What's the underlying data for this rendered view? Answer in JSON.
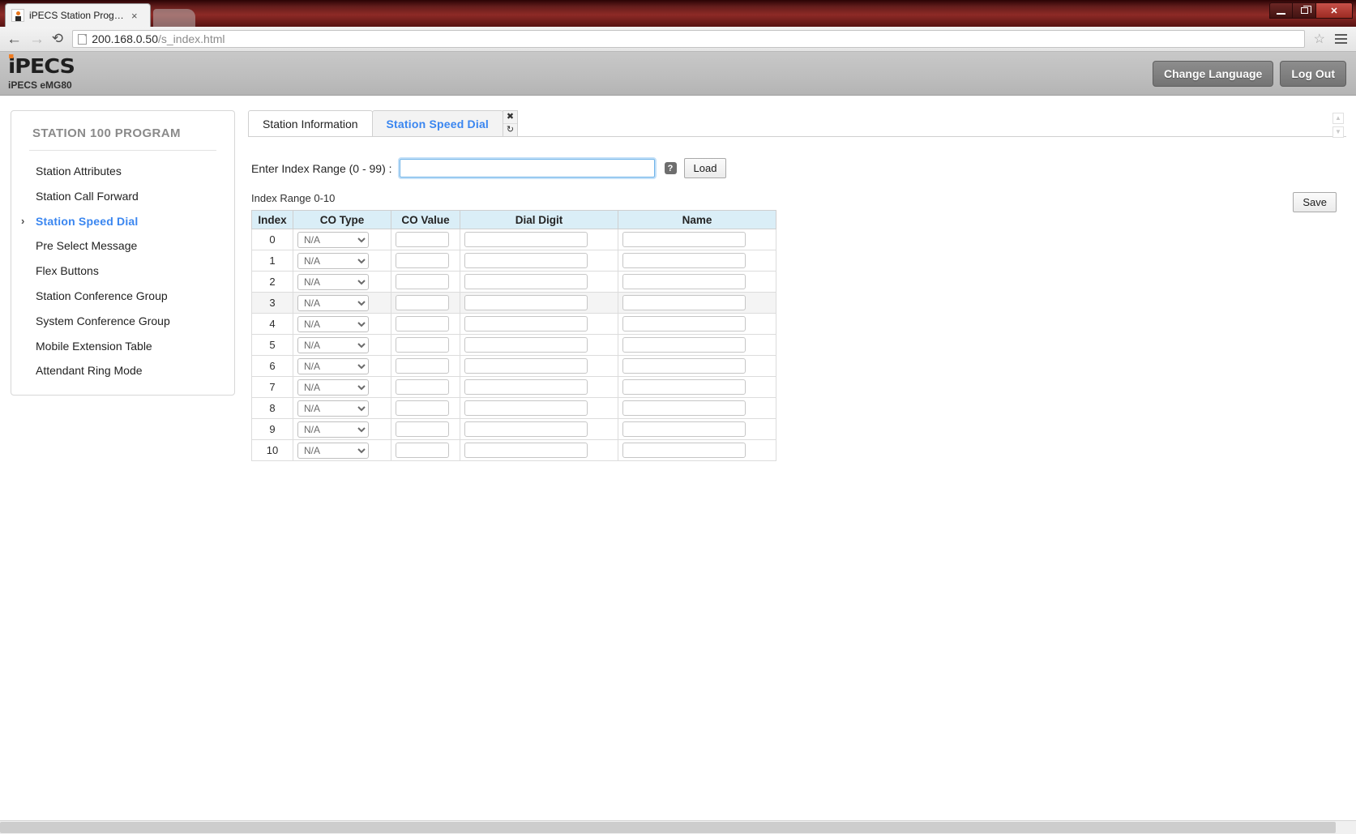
{
  "browser": {
    "tab_title": "iPECS Station Program",
    "tab_close_glyph": "×",
    "back_glyph": "←",
    "forward_glyph": "→",
    "reload_glyph": "⟳",
    "url": "200.168.0.50",
    "url_path": "/s_index.html",
    "star_glyph": "☆",
    "window_close_glyph": "✕"
  },
  "header": {
    "logo_text": "iPECS",
    "logo_subtitle": "iPECS eMG80",
    "change_language_label": "Change Language",
    "log_out_label": "Log Out",
    "accent_orange": "#f07c21"
  },
  "sidebar": {
    "title": "STATION 100 PROGRAM",
    "active_color": "#3a86f0",
    "caret_glyph": "›",
    "items": [
      {
        "label": "Station Attributes",
        "active": false
      },
      {
        "label": "Station Call Forward",
        "active": false
      },
      {
        "label": "Station Speed Dial",
        "active": true
      },
      {
        "label": "Pre Select Message",
        "active": false
      },
      {
        "label": "Flex Buttons",
        "active": false
      },
      {
        "label": "Station Conference Group",
        "active": false
      },
      {
        "label": "System Conference Group",
        "active": false
      },
      {
        "label": "Mobile Extension Table",
        "active": false
      },
      {
        "label": "Attendant Ring Mode",
        "active": false
      }
    ]
  },
  "tabs": {
    "items": [
      {
        "label": "Station Information",
        "selected": true
      },
      {
        "label": "Station  Speed  Dial",
        "selected": false
      }
    ],
    "close_glyph": "✖",
    "refresh_glyph": "↻",
    "scroll_up_glyph": "▲",
    "scroll_down_glyph": "▼"
  },
  "form": {
    "index_range_label": "Enter Index Range (0 - 99) :",
    "index_range_value": "",
    "index_range_placeholder": "",
    "help_glyph": "?",
    "load_label": "Load",
    "save_label": "Save"
  },
  "table": {
    "caption": "Index Range 0-10",
    "headers": [
      "Index",
      "CO Type",
      "CO Value",
      "Dial Digit",
      "Name"
    ],
    "co_type_options": [
      "N/A"
    ],
    "rows": [
      {
        "index": "0",
        "co_type": "N/A",
        "co_value": "",
        "dial_digit": "",
        "name": "",
        "shaded": false
      },
      {
        "index": "1",
        "co_type": "N/A",
        "co_value": "",
        "dial_digit": "",
        "name": "",
        "shaded": false
      },
      {
        "index": "2",
        "co_type": "N/A",
        "co_value": "",
        "dial_digit": "",
        "name": "",
        "shaded": false
      },
      {
        "index": "3",
        "co_type": "N/A",
        "co_value": "",
        "dial_digit": "",
        "name": "",
        "shaded": true
      },
      {
        "index": "4",
        "co_type": "N/A",
        "co_value": "",
        "dial_digit": "",
        "name": "",
        "shaded": false
      },
      {
        "index": "5",
        "co_type": "N/A",
        "co_value": "",
        "dial_digit": "",
        "name": "",
        "shaded": false
      },
      {
        "index": "6",
        "co_type": "N/A",
        "co_value": "",
        "dial_digit": "",
        "name": "",
        "shaded": false
      },
      {
        "index": "7",
        "co_type": "N/A",
        "co_value": "",
        "dial_digit": "",
        "name": "",
        "shaded": false
      },
      {
        "index": "8",
        "co_type": "N/A",
        "co_value": "",
        "dial_digit": "",
        "name": "",
        "shaded": false
      },
      {
        "index": "9",
        "co_type": "N/A",
        "co_value": "",
        "dial_digit": "",
        "name": "",
        "shaded": false
      },
      {
        "index": "10",
        "co_type": "N/A",
        "co_value": "",
        "dial_digit": "",
        "name": "",
        "shaded": false
      }
    ]
  }
}
